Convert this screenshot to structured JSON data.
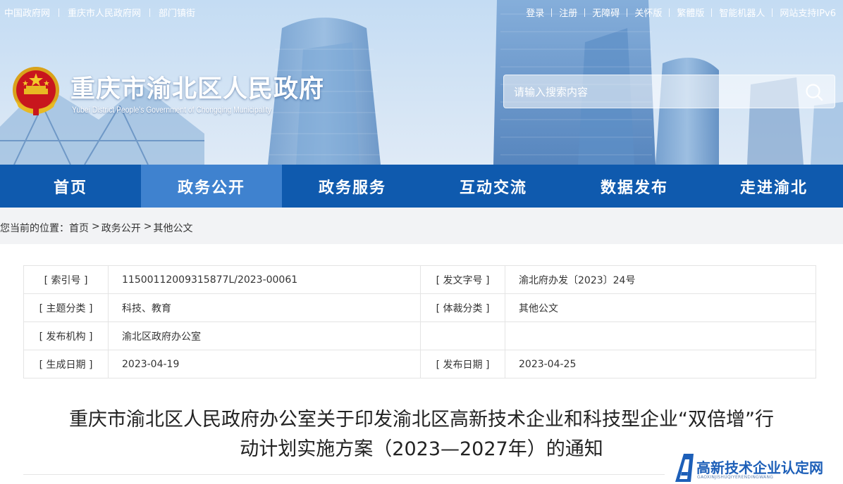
{
  "top_links_left": [
    "中国政府网",
    "重庆市人民政府网",
    "部门镇街"
  ],
  "top_links_right": [
    "登录",
    "注册",
    "无障碍",
    "关怀版",
    "繁體版",
    "智能机器人",
    "网站支持IPv6"
  ],
  "site": {
    "title": "重庆市渝北区人民政府",
    "subtitle": "Yubei District People's Government of Chongqing Municipality"
  },
  "search": {
    "placeholder": "请输入搜索内容",
    "value": ""
  },
  "nav": {
    "items": [
      "首页",
      "政务公开",
      "政务服务",
      "互动交流",
      "数据发布",
      "走进渝北"
    ],
    "active": "政务公开"
  },
  "breadcrumb": {
    "prefix": "您当前的位置：",
    "items": [
      "首页",
      "政务公开",
      "其他公文"
    ],
    "separator": ">"
  },
  "info": {
    "index_label": "[ 索引号 ]",
    "index_value": "11500112009315877L/2023-00061",
    "doc_no_label": "[ 发文字号 ]",
    "doc_no_value": "渝北府办发〔2023〕24号",
    "topic_label": "[ 主题分类 ]",
    "topic_value": "科技、教育",
    "genre_label": "[ 体裁分类 ]",
    "genre_value": "其他公文",
    "issuer_label": "[ 发布机构 ]",
    "issuer_value": "渝北区政府办公室",
    "created_label": "[ 生成日期 ]",
    "created_value": "2023-04-19",
    "published_label": "[ 发布日期 ]",
    "published_value": "2023-04-25"
  },
  "document": {
    "title_line1": "重庆市渝北区人民政府办公室关于印发渝北区高新技术企业和科技型企业“双倍增”行",
    "title_line2": "动计划实施方案（2023—2027年）的通知"
  },
  "watermark": {
    "text": "高新技术企业认定网",
    "sub": "GAOXINJISHUQIYERENDINGWANG"
  },
  "colors": {
    "nav_bg": "#0f5aae",
    "nav_active": "#3f82cf",
    "crumb_bg": "#f2f3f5",
    "watermark": "#1d5fb8"
  }
}
